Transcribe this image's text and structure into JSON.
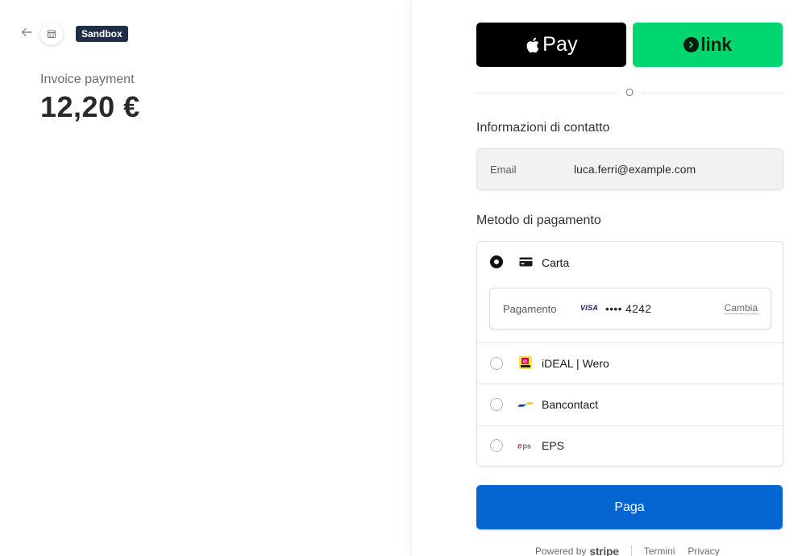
{
  "header": {
    "back_icon": "arrow-left-icon",
    "store_icon": "store-icon",
    "sandbox_label": "Sandbox"
  },
  "summary": {
    "label": "Invoice payment",
    "amount": "12,20 €"
  },
  "wallets": {
    "apple_pay_label": "Pay",
    "link_label": "link"
  },
  "divider_text": "O",
  "contact": {
    "title": "Informazioni di contatto",
    "email_label": "Email",
    "email_value": "luca.ferri@example.com"
  },
  "payment_method": {
    "title": "Metodo di pagamento",
    "selected": "card",
    "options": [
      {
        "id": "card",
        "label": "Carta",
        "icon": "credit-card-icon",
        "checked": true
      },
      {
        "id": "ideal",
        "label": "iDEAL | Wero",
        "icon": "ideal-icon",
        "checked": false
      },
      {
        "id": "bancontact",
        "label": "Bancontact",
        "icon": "bancontact-icon",
        "checked": false
      },
      {
        "id": "eps",
        "label": "EPS",
        "icon": "eps-icon",
        "checked": false
      }
    ],
    "saved_card": {
      "label": "Pagamento",
      "brand": "VISA",
      "number": "•••• 4242",
      "change_label": "Cambia"
    }
  },
  "pay_button_label": "Paga",
  "footer": {
    "powered_by": "Powered by",
    "brand": "stripe",
    "links": [
      "Termini",
      "Privacy"
    ]
  },
  "colors": {
    "pay_button": "#0566d1",
    "link_green": "#00d66f",
    "sandbox_badge": "#1f2d46"
  }
}
